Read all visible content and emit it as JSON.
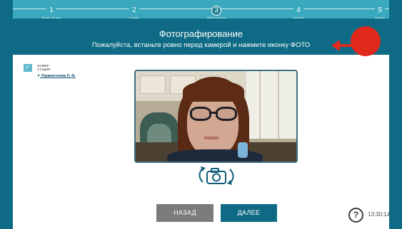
{
  "steps": [
    {
      "num": "1",
      "label": "Поиск брони"
    },
    {
      "num": "2",
      "label": "Номер"
    },
    {
      "num": "3",
      "label": "Регистрация",
      "current": true
    },
    {
      "num": "4",
      "label": "Оплата"
    },
    {
      "num": "5",
      "label": "Ключи"
    }
  ],
  "header": {
    "title": "Фотографирование",
    "subtitle": "Пожалуйста, встаньте ровно перед камерой и нажмите иконку ФОТО"
  },
  "sidebar": {
    "room_label_line1": "НОМЕР",
    "room_label_line2": "СТУДИЯ",
    "guest_name": "Управителева Н. Ф."
  },
  "camera": {
    "controls_icon": "rotate-camera-icon"
  },
  "buttons": {
    "back": "НАЗАД",
    "next": "ДАЛЕЕ"
  },
  "help_label": "?",
  "time": "13:30:14",
  "colors": {
    "primary": "#0f6b85",
    "steps_bg": "#3aa9bd",
    "back_button": "#7b7b7b",
    "annotation_red": "#e0281b"
  }
}
